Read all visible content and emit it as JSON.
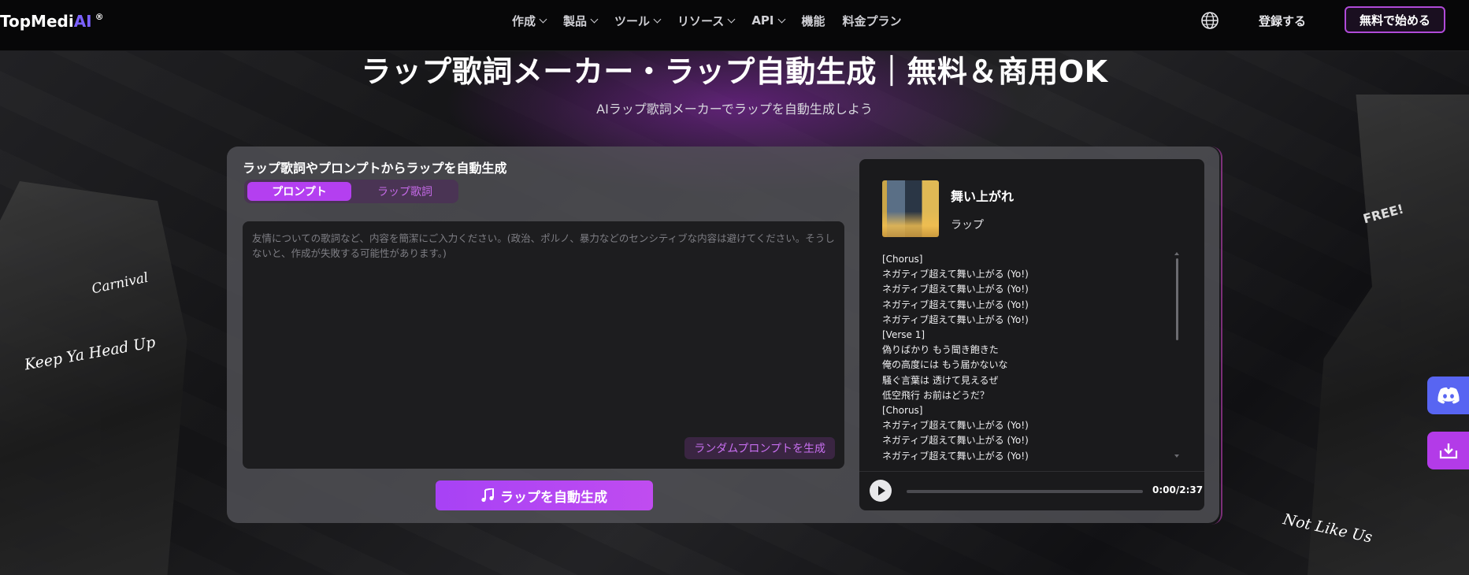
{
  "header": {
    "logo": "TopMedi",
    "logo_ai": "AI",
    "logo_mark": "®",
    "nav": [
      {
        "label": "作成",
        "has_menu": true
      },
      {
        "label": "製品",
        "has_menu": true
      },
      {
        "label": "ツール",
        "has_menu": true
      },
      {
        "label": "リソース",
        "has_menu": true
      },
      {
        "label": "API",
        "has_menu": true
      },
      {
        "label": "機能",
        "has_menu": false
      },
      {
        "label": "料金プラン",
        "has_menu": false
      }
    ],
    "login": "登録する",
    "start": "無料で始める"
  },
  "hero": {
    "title": "ラップ歌詞メーカー・ラップ自動生成｜無料＆商用OK",
    "subtitle": "AIラップ歌詞メーカーでラップを自動生成しよう"
  },
  "panel": {
    "heading": "ラップ歌詞やプロンプトからラップを自動生成",
    "tabs": [
      {
        "label": "プロンプト",
        "active": true
      },
      {
        "label": "ラップ歌詞",
        "active": false
      }
    ],
    "prompt_placeholder": "友情についての歌詞など、内容を簡潔にご入力ください。(政治、ポルノ、暴力などのセンシティブな内容は避けてください。そうしないと、作成が失敗する可能性があります。)",
    "random_button": "ランダムプロンプトを生成",
    "generate_button": "ラップを自動生成"
  },
  "player": {
    "title": "舞い上がれ",
    "genre": "ラップ",
    "lyrics": [
      "[Chorus]",
      "ネガティブ超えて舞い上がる (Yo!)",
      "ネガティブ超えて舞い上がる (Yo!)",
      "ネガティブ超えて舞い上がる (Yo!)",
      "ネガティブ超えて舞い上がる (Yo!)",
      "[Verse 1]",
      "偽りばかり もう聞き飽きた",
      "俺の高度には もう届かないな",
      "騒ぐ言葉は 透けて見えるぜ",
      "低空飛行 お前はどうだ？",
      "[Chorus]",
      "ネガティブ超えて舞い上がる (Yo!)",
      "ネガティブ超えて舞い上がる (Yo!)",
      "ネガティブ超えて舞い上がる (Yo!)"
    ],
    "time": "0:00/2:37",
    "progress": 0
  },
  "decor": {
    "left_1": "Carnival",
    "left_2": "Keep Ya Head Up",
    "right_1": "FREE!",
    "right_2": "Not Like Us"
  },
  "colors": {
    "accent": "#b43ff0",
    "discord": "#5865f2"
  }
}
